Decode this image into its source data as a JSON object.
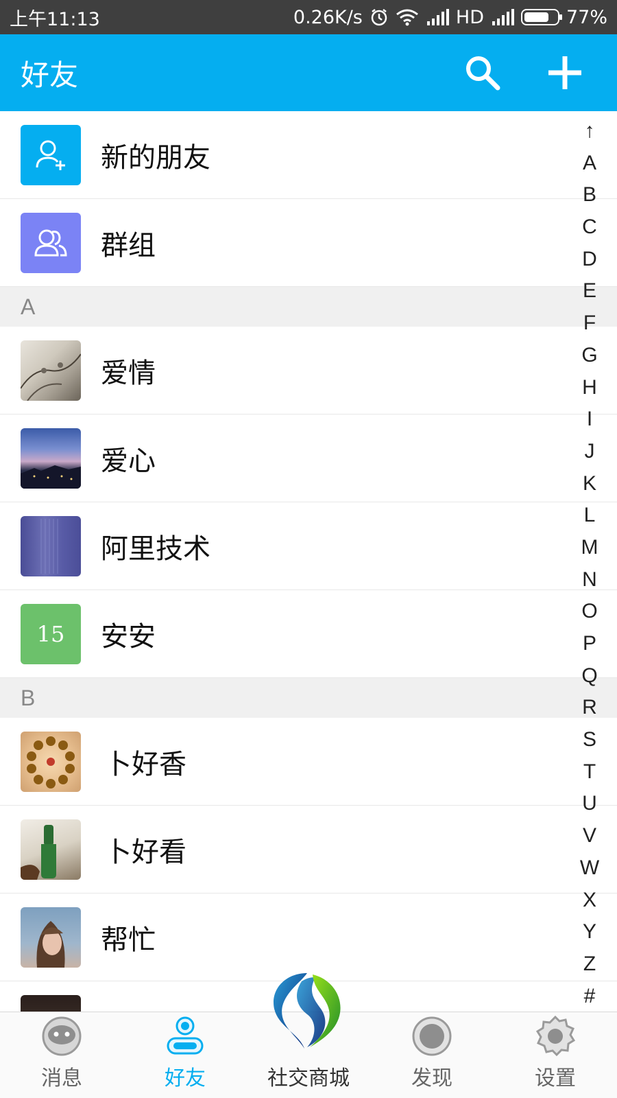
{
  "status_bar": {
    "time": "上午11:13",
    "net_speed": "0.26K/s",
    "network_type": "HD",
    "battery_percent": "77%",
    "battery_level": 0.77,
    "icons": [
      "alarm-icon",
      "wifi-icon",
      "signal-icon",
      "signal-icon",
      "battery-icon"
    ]
  },
  "header": {
    "title": "好友",
    "actions": [
      "search-icon",
      "add-icon"
    ]
  },
  "top_items": [
    {
      "label": "新的朋友",
      "icon": "add-user-icon",
      "color": "#05aef0"
    },
    {
      "label": "群组",
      "icon": "group-icon",
      "color": "#7b83f5"
    }
  ],
  "sections": [
    {
      "letter": "A",
      "contacts": [
        {
          "name": "爱情",
          "avatar": "photo"
        },
        {
          "name": "爱心",
          "avatar": "photo"
        },
        {
          "name": "阿里技术",
          "avatar": "photo"
        },
        {
          "name": "安安",
          "avatar": "text",
          "avatar_text": "15",
          "avatar_color": "#6cc16b"
        }
      ]
    },
    {
      "letter": "B",
      "contacts": [
        {
          "name": "卜好香",
          "avatar": "photo"
        },
        {
          "name": "卜好看",
          "avatar": "photo"
        },
        {
          "name": "帮忙",
          "avatar": "photo"
        }
      ]
    }
  ],
  "index_letters": [
    "↑",
    "A",
    "B",
    "C",
    "D",
    "E",
    "F",
    "G",
    "H",
    "I",
    "J",
    "K",
    "L",
    "M",
    "N",
    "O",
    "P",
    "Q",
    "R",
    "S",
    "T",
    "U",
    "V",
    "W",
    "X",
    "Y",
    "Z",
    "#"
  ],
  "bottom_nav": {
    "items": [
      {
        "label": "消息",
        "icon": "message-icon"
      },
      {
        "label": "好友",
        "icon": "friends-icon",
        "active": true
      },
      {
        "label": "社交商城",
        "icon": "mall-logo-icon"
      },
      {
        "label": "发现",
        "icon": "discover-icon"
      },
      {
        "label": "设置",
        "icon": "settings-icon"
      }
    ]
  },
  "colors": {
    "accent": "#05aef0",
    "status_bar": "#3f3f3f",
    "section_bg": "#f0f0f0",
    "group_tile": "#7b83f5",
    "green_avatar": "#6cc16b"
  }
}
